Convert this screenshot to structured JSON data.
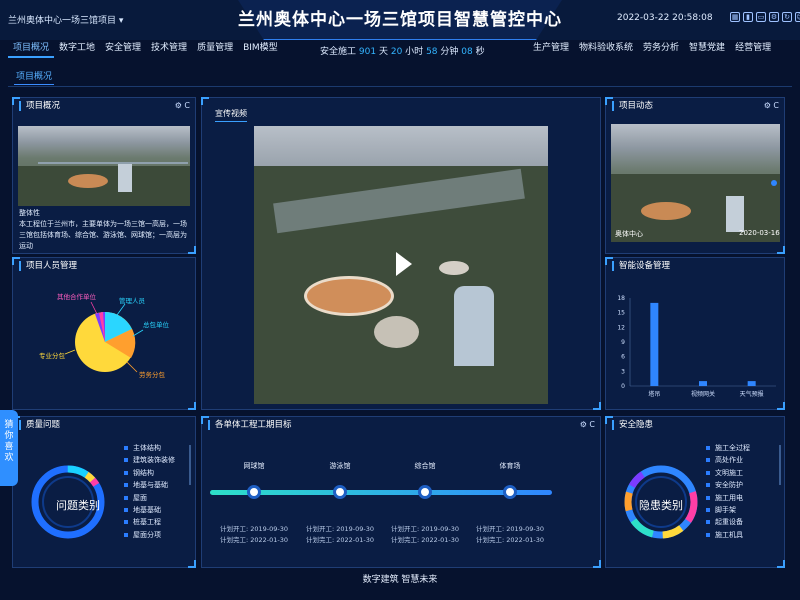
{
  "header": {
    "project": "兰州奥体中心一场三馆项目",
    "title": "兰州奥体中心一场三馆项目智慧管控中心",
    "datetime": "2022-03-22 20:58:08"
  },
  "nav_left": [
    "项目概况",
    "数字工地",
    "安全管理",
    "技术管理",
    "质量管理",
    "BIM模型"
  ],
  "nav_right": [
    "生产管理",
    "物料验收系统",
    "劳务分析",
    "智慧党建",
    "经营管理"
  ],
  "safety": {
    "prefix": "安全施工",
    "days": "901",
    "days_unit": "天",
    "hours": "20",
    "hours_unit": "小时",
    "minutes": "58",
    "minutes_unit": "分钟",
    "seconds": "08",
    "seconds_unit": "秒"
  },
  "subtab": "项目概况",
  "overview": {
    "title": "项目概况",
    "heading": "整体性",
    "text": "本工程位于兰州市，主要单体为一场三馆一高层，一场三馆包括体育场、综合馆、游泳馆、网球馆；一高层为运动"
  },
  "video": {
    "tab": "宣传视频"
  },
  "dynamics": {
    "title": "项目动态",
    "caption": "奥体中心",
    "date": "2020-03-16"
  },
  "personnel": {
    "title": "项目人员管理",
    "labels": [
      "其他合作单位",
      "管理人员",
      "总包单位",
      "劳务分包",
      "专业分包"
    ]
  },
  "devices": {
    "title": "智能设备管理"
  },
  "quality": {
    "title": "质量问题",
    "center": "问题类别",
    "items": [
      "主体结构",
      "建筑装饰装修",
      "钢结构",
      "地基与基础",
      "屋面",
      "地基基础",
      "桩基工程",
      "屋面分项"
    ]
  },
  "milestones": {
    "title": "各单体工程工期目标",
    "buildings": [
      {
        "name": "网球馆",
        "start": "计划开工: 2019-09-30",
        "end": "计划完工: 2022-01-30"
      },
      {
        "name": "游泳馆",
        "start": "计划开工: 2019-09-30",
        "end": "计划完工: 2022-01-30"
      },
      {
        "name": "综合馆",
        "start": "计划开工: 2019-09-30",
        "end": "计划完工: 2022-01-30"
      },
      {
        "name": "体育场",
        "start": "计划开工: 2019-09-30",
        "end": "计划完工: 2022-01-30"
      }
    ]
  },
  "hazards": {
    "title": "安全隐患",
    "center": "隐患类别",
    "items": [
      "施工全过程",
      "高处作业",
      "文明施工",
      "安全防护",
      "施工用电",
      "脚手架",
      "起重设备",
      "施工机具"
    ]
  },
  "sidetab": "猜你喜欢",
  "footer": "数字建筑 智慧未来",
  "chart_data": {
    "type": "bar",
    "categories": [
      "塔吊",
      "视频网关",
      "天气预报"
    ],
    "values": [
      17,
      1,
      1
    ],
    "ylim": [
      0,
      18
    ],
    "yticks": [
      0,
      3,
      6,
      9,
      12,
      15,
      18
    ],
    "color": "#2f86ff"
  },
  "colors": {
    "accent": "#3aa0ff",
    "bg": "#06122e",
    "panel": "#0a1d44"
  }
}
